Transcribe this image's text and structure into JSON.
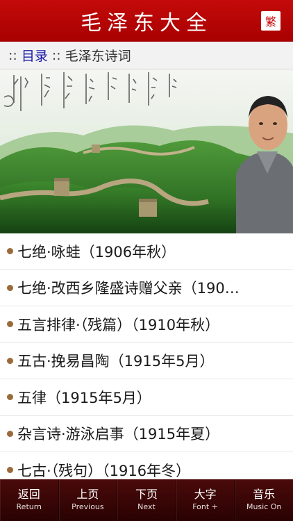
{
  "header": {
    "title": "毛泽东大全",
    "traditional_button": "繁"
  },
  "breadcrumb": {
    "prefix": "::",
    "link": "目录",
    "separator": "::",
    "current": "毛泽东诗词"
  },
  "banner": {
    "description_icon": "great-wall-banner"
  },
  "poems": [
    "七绝·咏蛙（1906年秋）",
    "七绝·改西乡隆盛诗赠父亲（190…",
    "五言排律·（残篇）（1910年秋）",
    "五古·挽易昌陶（1915年5月）",
    "五律（1915年5月）",
    "杂言诗·游泳启事（1915年夏）",
    "七古·（残句）（1916年冬）"
  ],
  "tabbar": [
    {
      "zh": "返回",
      "en": "Return"
    },
    {
      "zh": "上页",
      "en": "Previous"
    },
    {
      "zh": "下页",
      "en": "Next"
    },
    {
      "zh": "大字",
      "en": "Font +"
    },
    {
      "zh": "音乐",
      "en": "Music On"
    }
  ],
  "colors": {
    "header": "#b00000",
    "link": "#1a1aa8",
    "bullet": "#9a6a3a",
    "tabbar": "#3a0505"
  }
}
